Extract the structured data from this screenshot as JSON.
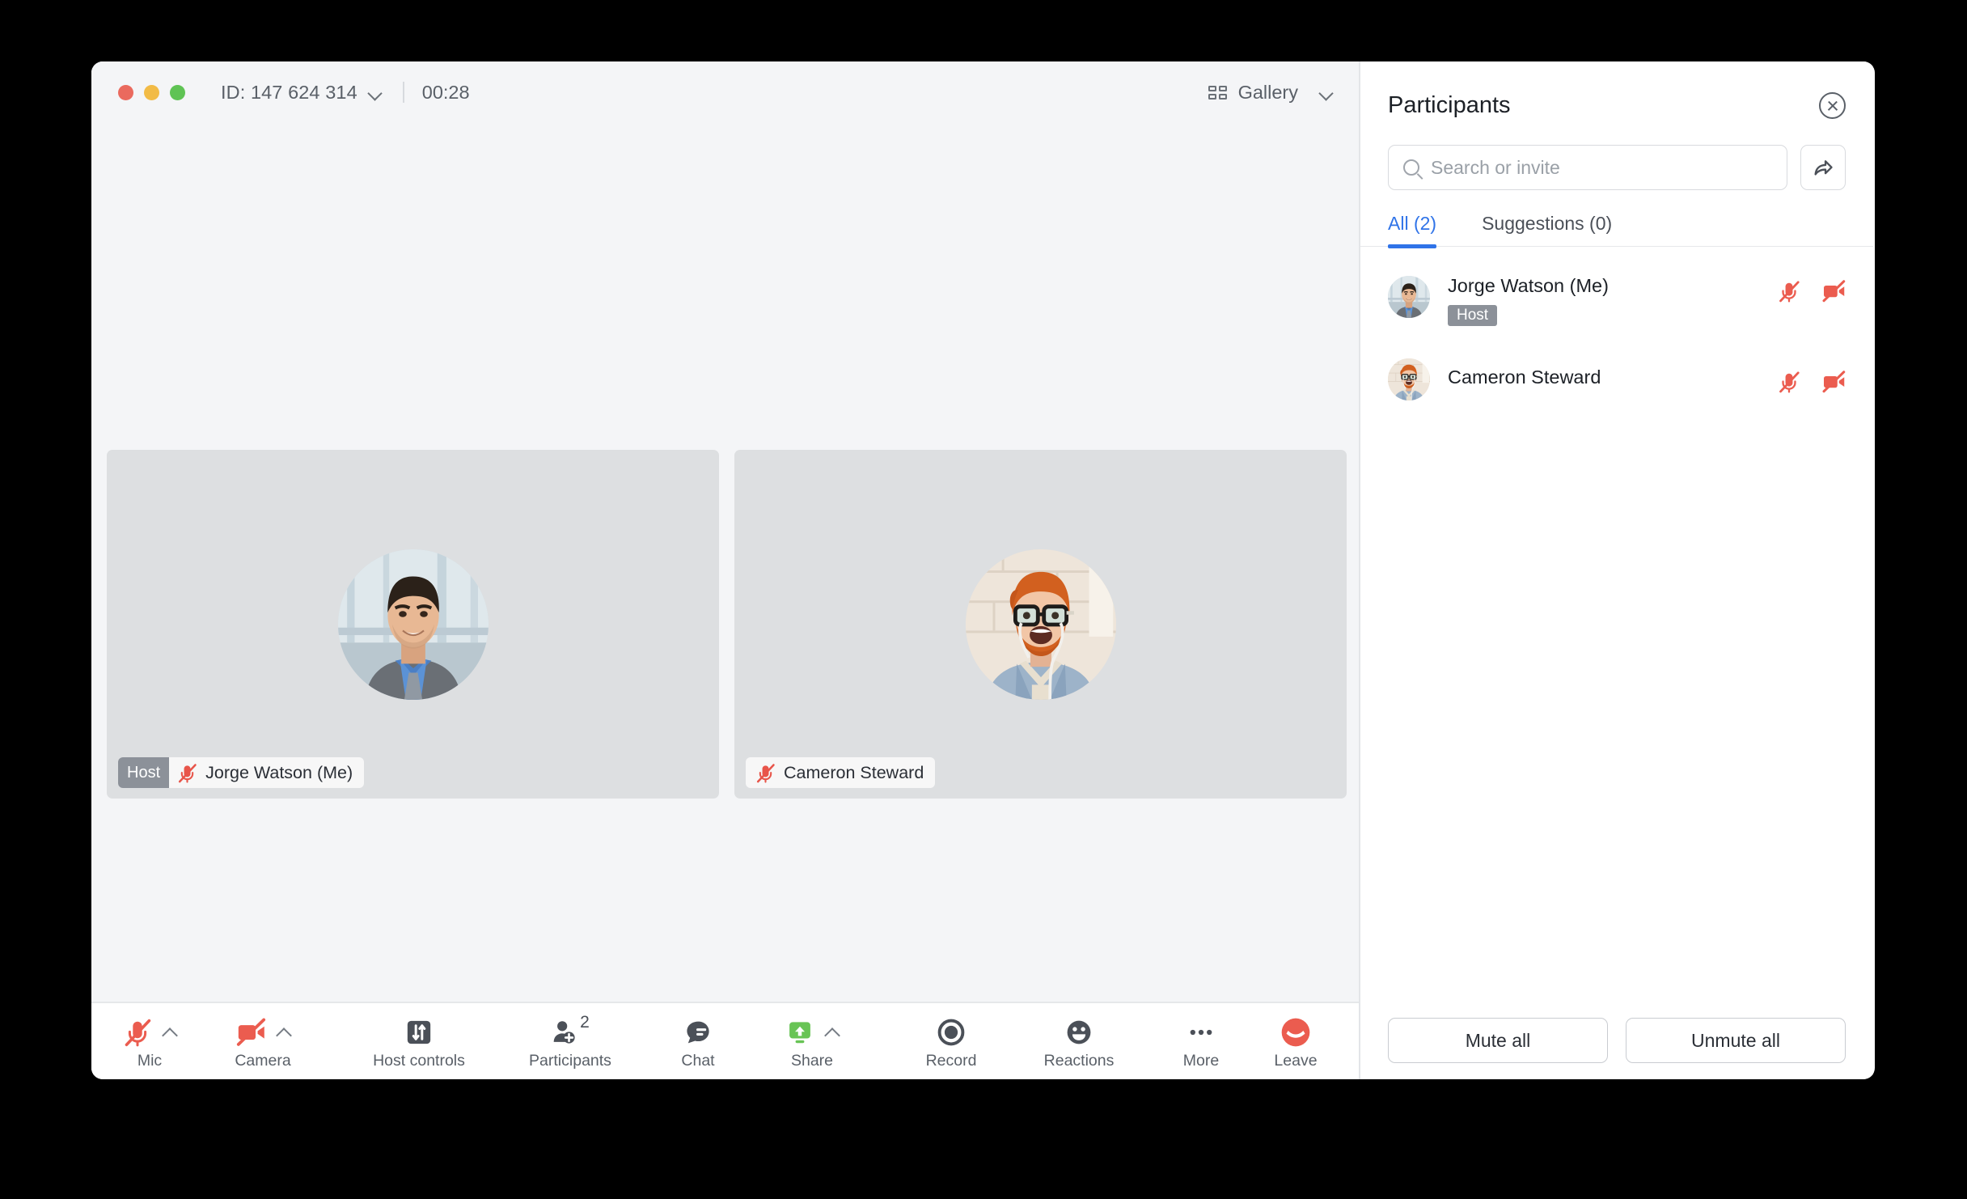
{
  "window": {
    "traffic_lights": [
      "close",
      "minimize",
      "zoom"
    ],
    "colors": {
      "red": "#ea6a5e",
      "yellow": "#f2bb46",
      "green": "#5fc354"
    }
  },
  "titlebar": {
    "meeting_id": "ID: 147 624 314",
    "dropdown_icon": "chevron-down-icon",
    "timer": "00:28",
    "view_mode": "Gallery",
    "view_mode_icon": "grid-icon",
    "view_mode_caret": "chevron-down-icon"
  },
  "stage": {
    "tiles": [
      {
        "name": "Jorge Watson (Me)",
        "host_label": "Host",
        "is_host": true,
        "muted": true,
        "mic_icon": "mic-off-icon"
      },
      {
        "name": "Cameron Steward",
        "host_label": "",
        "is_host": false,
        "muted": true,
        "mic_icon": "mic-off-icon"
      }
    ]
  },
  "toolbar": {
    "items": [
      {
        "label": "Mic",
        "icon": "mic-off-icon",
        "caret": true,
        "state": "off"
      },
      {
        "label": "Camera",
        "icon": "camera-off-icon",
        "caret": true,
        "state": "off"
      },
      {
        "label": "Host controls",
        "icon": "sliders-icon",
        "caret": false,
        "state": "normal"
      },
      {
        "label": "Participants",
        "icon": "add-person-icon",
        "caret": false,
        "state": "normal",
        "badge": "2"
      },
      {
        "label": "Chat",
        "icon": "chat-bubble-icon",
        "caret": false,
        "state": "normal"
      },
      {
        "label": "Share",
        "icon": "share-screen-icon",
        "caret": true,
        "state": "normal"
      },
      {
        "label": "Record",
        "icon": "record-circle-icon",
        "caret": false,
        "state": "normal"
      },
      {
        "label": "Reactions",
        "icon": "smiley-icon",
        "caret": false,
        "state": "normal"
      },
      {
        "label": "More",
        "icon": "ellipsis-icon",
        "caret": false,
        "state": "normal"
      },
      {
        "label": "Leave",
        "icon": "end-call-icon",
        "caret": false,
        "state": "danger"
      }
    ],
    "accent_colors": {
      "danger": "#eb5c4f",
      "share_green": "#68c455",
      "neutral": "#4b5058"
    }
  },
  "panel": {
    "title": "Participants",
    "close_icon": "close-circle-icon",
    "search": {
      "placeholder": "Search or invite",
      "value": "",
      "icon": "search-icon"
    },
    "invite_button_icon": "share-arrow-icon",
    "tabs": [
      {
        "label": "All (2)",
        "active": true
      },
      {
        "label": "Suggestions (0)",
        "active": false
      }
    ],
    "tab_accent": "#2f73e8",
    "participants": [
      {
        "name": "Jorge Watson (Me)",
        "role_tag": "Host",
        "has_role_tag": true,
        "mic_icon": "mic-off-icon",
        "camera_icon": "camera-off-icon"
      },
      {
        "name": "Cameron Steward",
        "role_tag": "",
        "has_role_tag": false,
        "mic_icon": "mic-off-icon",
        "camera_icon": "camera-off-icon"
      }
    ],
    "footer": {
      "mute_all": "Mute all",
      "unmute_all": "Unmute all"
    }
  }
}
